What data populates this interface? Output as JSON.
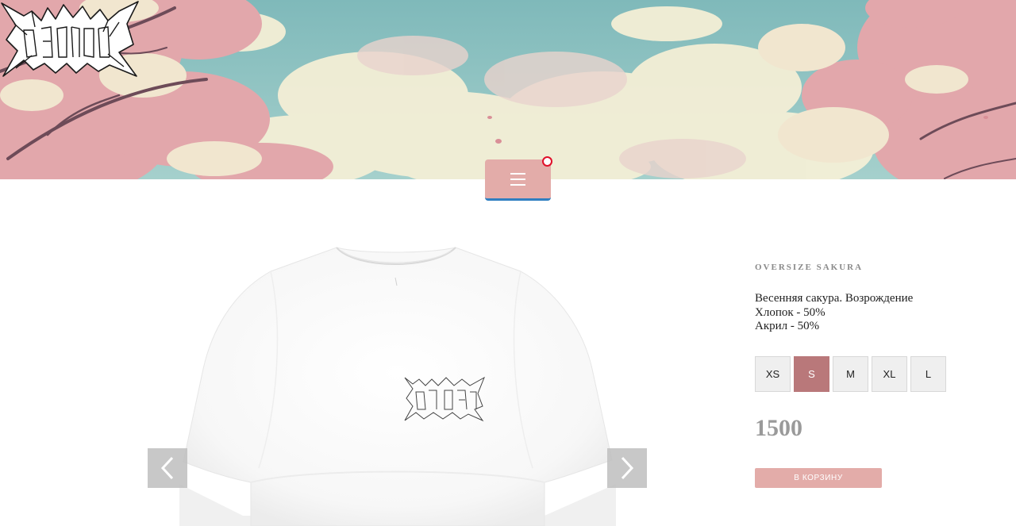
{
  "header": {
    "logo_icon": "metal-band-logo",
    "background": "sakura-sky-illustration",
    "colors": {
      "sky": "#8fc3c3",
      "blossom": "#e2a9ad",
      "cloud": "#f6f1da"
    }
  },
  "menu": {
    "icon": "hamburger-icon",
    "color": "#e3aca9",
    "underline_color": "#2f7fc1",
    "notification_color": "#e0102a"
  },
  "gallery": {
    "prev_icon": "chevron-left-icon",
    "next_icon": "chevron-right-icon",
    "image": "white-oversize-tshirt-with-logo"
  },
  "product": {
    "title": "OVERSIZE SAKURA",
    "description": [
      "Весенняя сакура. Возрождение",
      "Хлопок - 50%",
      "Акрил - 50%"
    ],
    "sizes": [
      "XS",
      "S",
      "M",
      "XL",
      "L"
    ],
    "selected_size": "S",
    "price": "1500",
    "cart_button": "В КОРЗИНУ",
    "colors": {
      "accent": "#e3aca9",
      "selected_size": "#b9787a",
      "price": "#9a9a9a"
    }
  }
}
